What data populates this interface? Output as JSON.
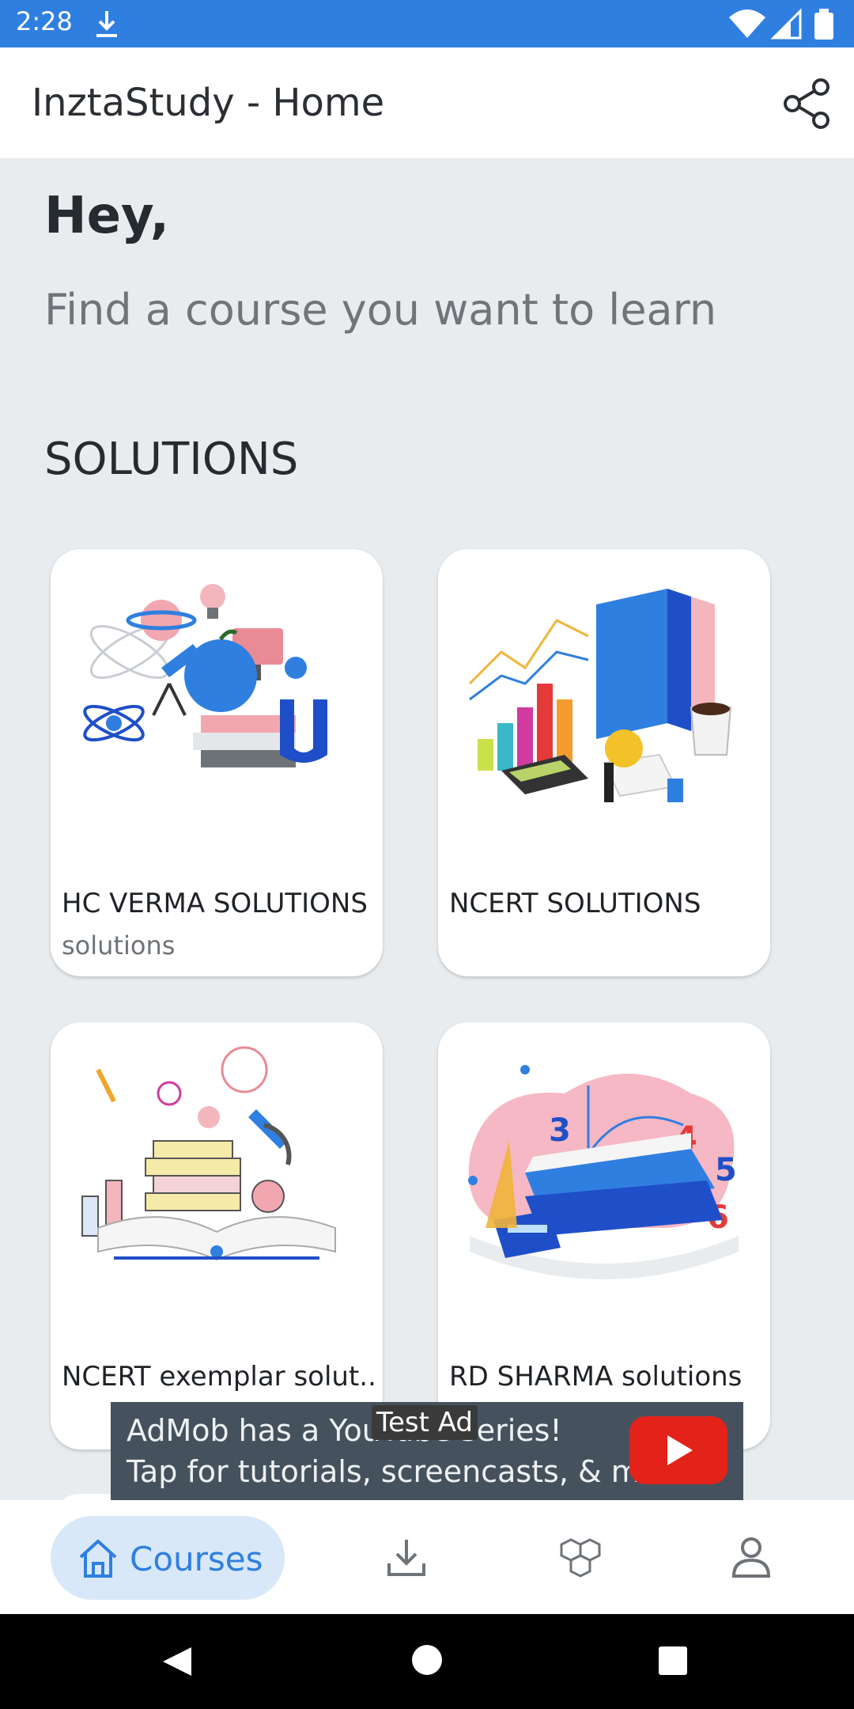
{
  "status_bar": {
    "time": "2:28"
  },
  "app_bar": {
    "title": "InztaStudy - Home"
  },
  "greeting": "Hey,",
  "subtitle": "Find a course you want to learn",
  "section_title": "SOLUTIONS",
  "cards": [
    {
      "title": "HC VERMA SOLUTIONS",
      "subtitle": "solutions"
    },
    {
      "title": "NCERT SOLUTIONS",
      "subtitle": ""
    },
    {
      "title": "NCERT  exemplar solut..",
      "subtitle": ""
    },
    {
      "title": "RD SHARMA solutions",
      "subtitle": ""
    }
  ],
  "ad": {
    "line1": "AdMob has a YouTube series!",
    "line2": "Tap for tutorials, screencasts, & more.",
    "badge": "Test Ad"
  },
  "bottom_nav": {
    "items": [
      {
        "label": "Courses",
        "icon": "home-icon",
        "active": true
      },
      {
        "label": "",
        "icon": "download-icon",
        "active": false
      },
      {
        "label": "",
        "icon": "cubes-icon",
        "active": false
      },
      {
        "label": "",
        "icon": "profile-icon",
        "active": false
      }
    ]
  },
  "colors": {
    "status_bar": "#2f7fe0",
    "accent": "#2f7fe0",
    "background": "#e9ecef",
    "nav_pill": "#d8e8f8",
    "ad_background": "#45525d",
    "youtube_red": "#e3221a"
  }
}
